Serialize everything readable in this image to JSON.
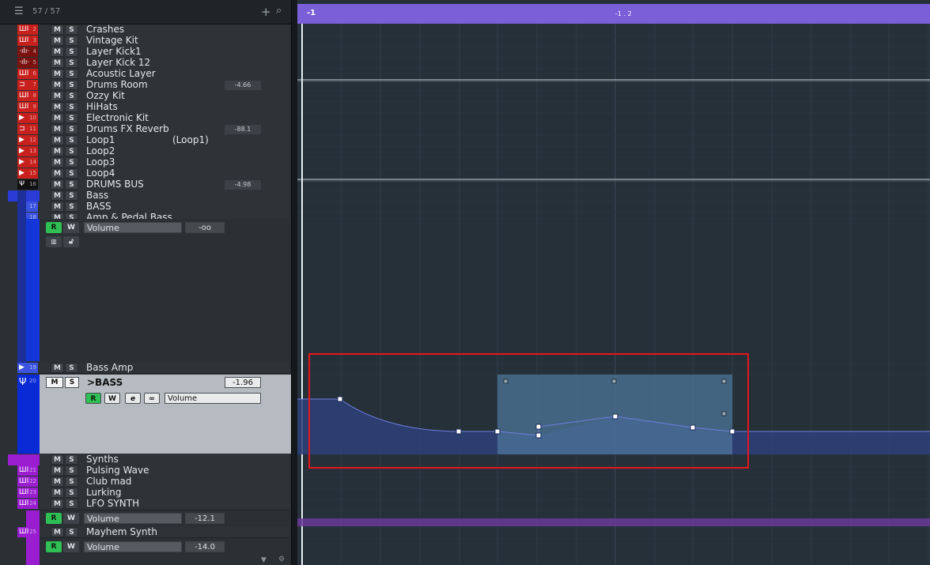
{
  "toolbar": {
    "track_count": "57 / 57"
  },
  "tracks": [
    {
      "name": "Crashes",
      "num": "2",
      "color": "#c8201c",
      "glyph": "ШI"
    },
    {
      "name": "Vintage Kit",
      "num": "3",
      "color": "#c8201c",
      "glyph": "ШI"
    },
    {
      "name": "Layer Kick1",
      "num": "4",
      "color": "#7a1210",
      "glyph": "·ılı·"
    },
    {
      "name": "Layer Kick 12",
      "num": "5",
      "color": "#7a1210",
      "glyph": "·ılı·"
    },
    {
      "name": "Acoustic Layer",
      "num": "6",
      "color": "#c8201c",
      "glyph": "ШI"
    },
    {
      "name": "Drums Room",
      "num": "7",
      "color": "#c8201c",
      "glyph": "⊐",
      "value": "-4.66"
    },
    {
      "name": "Ozzy Kit",
      "num": "8",
      "color": "#c8201c",
      "glyph": "ШI"
    },
    {
      "name": "HiHats",
      "num": "9",
      "color": "#c8201c",
      "glyph": "ШI"
    },
    {
      "name": "Electronic Kit",
      "num": "10",
      "color": "#c8201c",
      "glyph": "▶"
    },
    {
      "name": "Drums FX Reverb",
      "num": "11",
      "color": "#c8201c",
      "glyph": "⊐",
      "value": "-88.1"
    },
    {
      "name": "Loop1",
      "num": "12",
      "color": "#c8201c",
      "glyph": "▶",
      "extra": "(Loop1)"
    },
    {
      "name": "Loop2",
      "num": "13",
      "color": "#c8201c",
      "glyph": "▶"
    },
    {
      "name": "Loop3",
      "num": "14",
      "color": "#c8201c",
      "glyph": "▶"
    },
    {
      "name": "Loop4",
      "num": "15",
      "color": "#c8201c",
      "glyph": "▶"
    },
    {
      "name": "DRUMS BUS",
      "num": "16",
      "color": "#111111",
      "glyph": "Ψ",
      "value": "-4.98"
    },
    {
      "name": "Bass",
      "num": "",
      "color": "#2a3bd6",
      "glyph": "▭",
      "folder": true
    },
    {
      "name": "BASS",
      "num": "17",
      "color": "#3a54e0",
      "glyph": "▶"
    },
    {
      "name": "Amp & Pedal Bass",
      "num": "18",
      "color": "#3a54e0",
      "glyph": "▶"
    }
  ],
  "bass_auto": {
    "param": "Volume",
    "value": "-oo"
  },
  "bass_amp": {
    "name": "Bass Amp",
    "num": "19"
  },
  "selected_track": {
    "name": ">BASS",
    "num": "20",
    "value": "-1.96",
    "param": "Volume"
  },
  "synth_tracks": [
    {
      "name": "Synths",
      "num": "",
      "color": "#9a1ed0",
      "glyph": "▭"
    },
    {
      "name": "Pulsing Wave",
      "num": "21",
      "color": "#9a1ed0",
      "glyph": "ШI"
    },
    {
      "name": "Club mad",
      "num": "22",
      "color": "#9a1ed0",
      "glyph": "ШI"
    },
    {
      "name": "Lurking",
      "num": "23",
      "color": "#9a1ed0",
      "glyph": "ШI"
    },
    {
      "name": "LFO SYNTH",
      "num": "24",
      "color": "#9a1ed0",
      "glyph": "ШI"
    }
  ],
  "lfo_auto": {
    "param": "Volume",
    "value": "-12.1"
  },
  "mayhem": {
    "name": "Mayhem Synth",
    "num": "25",
    "param": "Volume",
    "value": "-14.0"
  },
  "buttons": {
    "mute": "M",
    "solo": "S",
    "read": "R",
    "write": "W",
    "edit": "e",
    "link": "∞"
  },
  "ruler": {
    "start": "-1",
    "mid": "-1 . 2"
  },
  "colors": {
    "ruler": "#7a5fd9",
    "selection": "#e8151b",
    "curve_fill": "#2e3f7a",
    "accent_green": "#2fbf54"
  }
}
